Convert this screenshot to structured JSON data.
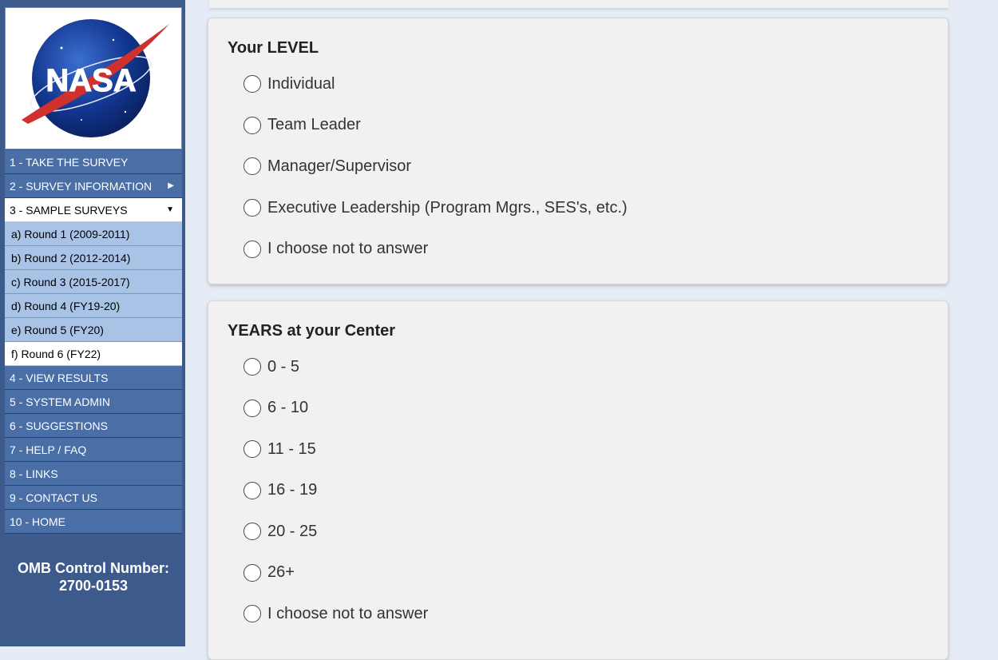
{
  "sidebar": {
    "logo_text": "NASA",
    "nav": [
      {
        "label": "1 - TAKE THE SURVEY"
      },
      {
        "label": "2 - SURVEY INFORMATION",
        "caret": "▶"
      },
      {
        "label": "3 - SAMPLE SURVEYS",
        "caret": "▼",
        "active": true
      },
      {
        "label": "a) Round 1 (2009-2011)",
        "sub": true
      },
      {
        "label": "b) Round 2 (2012-2014)",
        "sub": true
      },
      {
        "label": "c) Round 3 (2015-2017)",
        "sub": true
      },
      {
        "label": "d) Round 4 (FY19-20)",
        "sub": true
      },
      {
        "label": "e) Round 5 (FY20)",
        "sub": true
      },
      {
        "label": "f) Round 6 (FY22)",
        "sub": true,
        "active": true
      },
      {
        "label": "4 - VIEW RESULTS"
      },
      {
        "label": "5 - SYSTEM ADMIN"
      },
      {
        "label": "6 - SUGGESTIONS"
      },
      {
        "label": "7 - HELP / FAQ"
      },
      {
        "label": "8 - LINKS"
      },
      {
        "label": "9 - CONTACT US"
      },
      {
        "label": "10 - HOME"
      }
    ],
    "omb_label": "OMB Control Number:",
    "omb_number": "2700-0153"
  },
  "level_question": {
    "title": "Your LEVEL",
    "options": [
      "Individual",
      "Team Leader",
      "Manager/Supervisor",
      "Executive Leadership (Program Mgrs., SES's, etc.)",
      "I choose not to answer"
    ]
  },
  "years_question": {
    "title": "YEARS at your Center",
    "options": [
      "0 - 5",
      "6 - 10",
      "11 - 15",
      "16 - 19",
      "20 - 25",
      "26+",
      "I choose not to answer"
    ]
  },
  "colors": {
    "sidebar_bg": "#3d5a8c",
    "nav_bg": "#4a6ea6",
    "sub_nav_bg": "#a9c3e6",
    "page_bg": "#e6ecf6",
    "card_bg": "#f1f1f1"
  }
}
